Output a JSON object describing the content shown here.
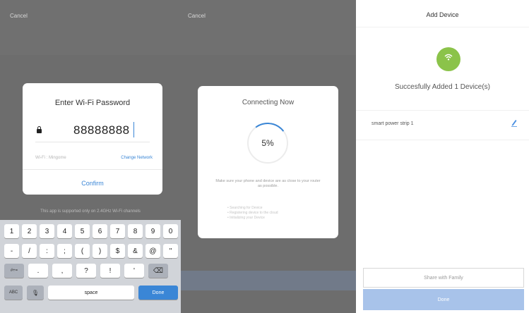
{
  "wifi_panel": {
    "cancel": "Cancel",
    "title": "Enter Wi-Fi Password",
    "password": "88888888",
    "network": "Wi-Fi : Mingome",
    "change_network": "Change Network",
    "confirm": "Confirm",
    "support_note": "This app is supported only on 2.4GHz Wi-Fi channels"
  },
  "keyboard": {
    "row1": [
      "1",
      "2",
      "3",
      "4",
      "5",
      "6",
      "7",
      "8",
      "9",
      "0"
    ],
    "row2": [
      "-",
      "/",
      ":",
      ";",
      "(",
      ")",
      "$",
      "&",
      "@",
      "\""
    ],
    "row3_mode": "#+=",
    "row3": [
      ".",
      ",",
      "?",
      "!",
      "'"
    ],
    "delete": "⌫",
    "mode": "ABC",
    "mic": "🎙",
    "space": "space",
    "done": "Done"
  },
  "connecting_panel": {
    "cancel": "Cancel",
    "title": "Connecting Now",
    "percent": "5%",
    "hint": "Make sure your phone and device are as close to your router as possible.",
    "steps": [
      "Searching for Device",
      "Registering device to the cloud",
      "Initializing your Device"
    ]
  },
  "success_panel": {
    "title": "Add Device",
    "message": "Succesfully Added 1 Device(s)",
    "device_name": "smart power strip 1",
    "share": "Share with Family",
    "done": "Done"
  }
}
